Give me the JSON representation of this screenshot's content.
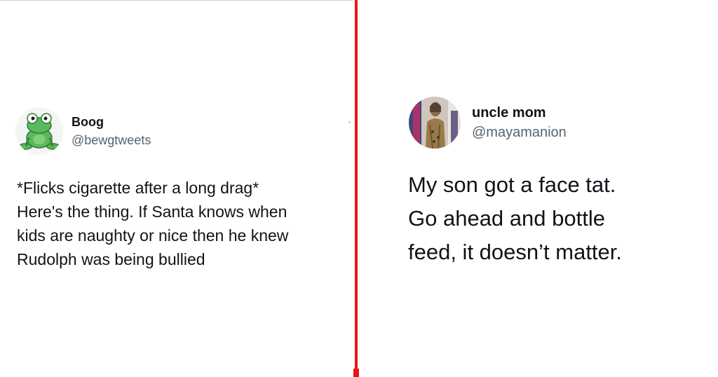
{
  "left_tweet": {
    "display_name": "Boog",
    "handle": "@bewgtweets",
    "text": "*Flicks cigarette after a long drag*\nHere's the thing. If Santa knows when\nkids are naughty or nice then he knew\nRudolph was being bullied",
    "avatar_icon": "frog-icon"
  },
  "right_tweet": {
    "display_name": "uncle mom",
    "handle": "@mayamanion",
    "text": "My son got a face tat.\nGo ahead and bottle\nfeed, it doesn’t matter.",
    "avatar_icon": "user-photo-icon"
  },
  "colors": {
    "divider": "#e8161b",
    "text_primary": "#0f1419",
    "text_secondary": "#536471",
    "frog_green": "#5cb85c"
  }
}
